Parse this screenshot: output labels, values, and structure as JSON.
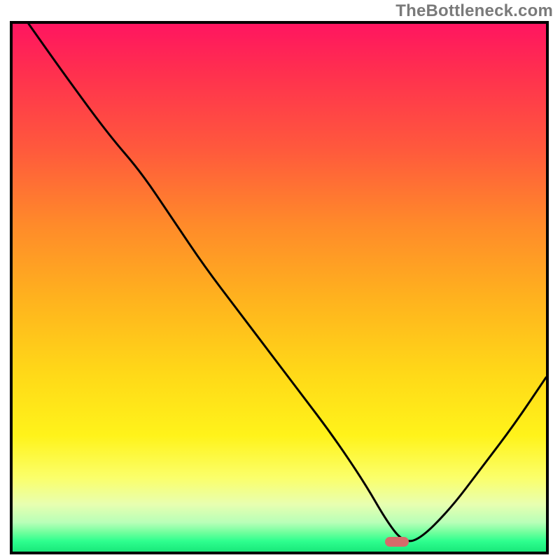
{
  "watermark": "TheBottleneck.com",
  "colors": {
    "border": "#000000",
    "curve": "#000000",
    "marker": "#d66a6a",
    "gradient_top": "#ff1560",
    "gradient_bottom": "#18e87a"
  },
  "chart_data": {
    "type": "line",
    "title": "",
    "xlabel": "",
    "ylabel": "",
    "xlim": [
      0,
      100
    ],
    "ylim": [
      0,
      100
    ],
    "grid": false,
    "marker": {
      "x": 72,
      "y": 1.8,
      "shape": "rounded-rect"
    },
    "series": [
      {
        "name": "bottleneck-curve",
        "x": [
          3,
          10,
          18,
          24,
          30,
          36,
          42,
          48,
          54,
          60,
          66,
          70,
          73,
          76,
          82,
          88,
          94,
          100
        ],
        "y": [
          100,
          90,
          79,
          72,
          63,
          54,
          46,
          38,
          30,
          22,
          13,
          6,
          2,
          2,
          8,
          16,
          24,
          33
        ]
      }
    ],
    "background": {
      "type": "vertical-gradient",
      "stops": [
        {
          "pos": 0.0,
          "color": "#ff1560"
        },
        {
          "pos": 0.24,
          "color": "#ff5a3c"
        },
        {
          "pos": 0.52,
          "color": "#ffb21e"
        },
        {
          "pos": 0.78,
          "color": "#fff31a"
        },
        {
          "pos": 0.91,
          "color": "#e8ffb0"
        },
        {
          "pos": 1.0,
          "color": "#18e87a"
        }
      ]
    }
  }
}
